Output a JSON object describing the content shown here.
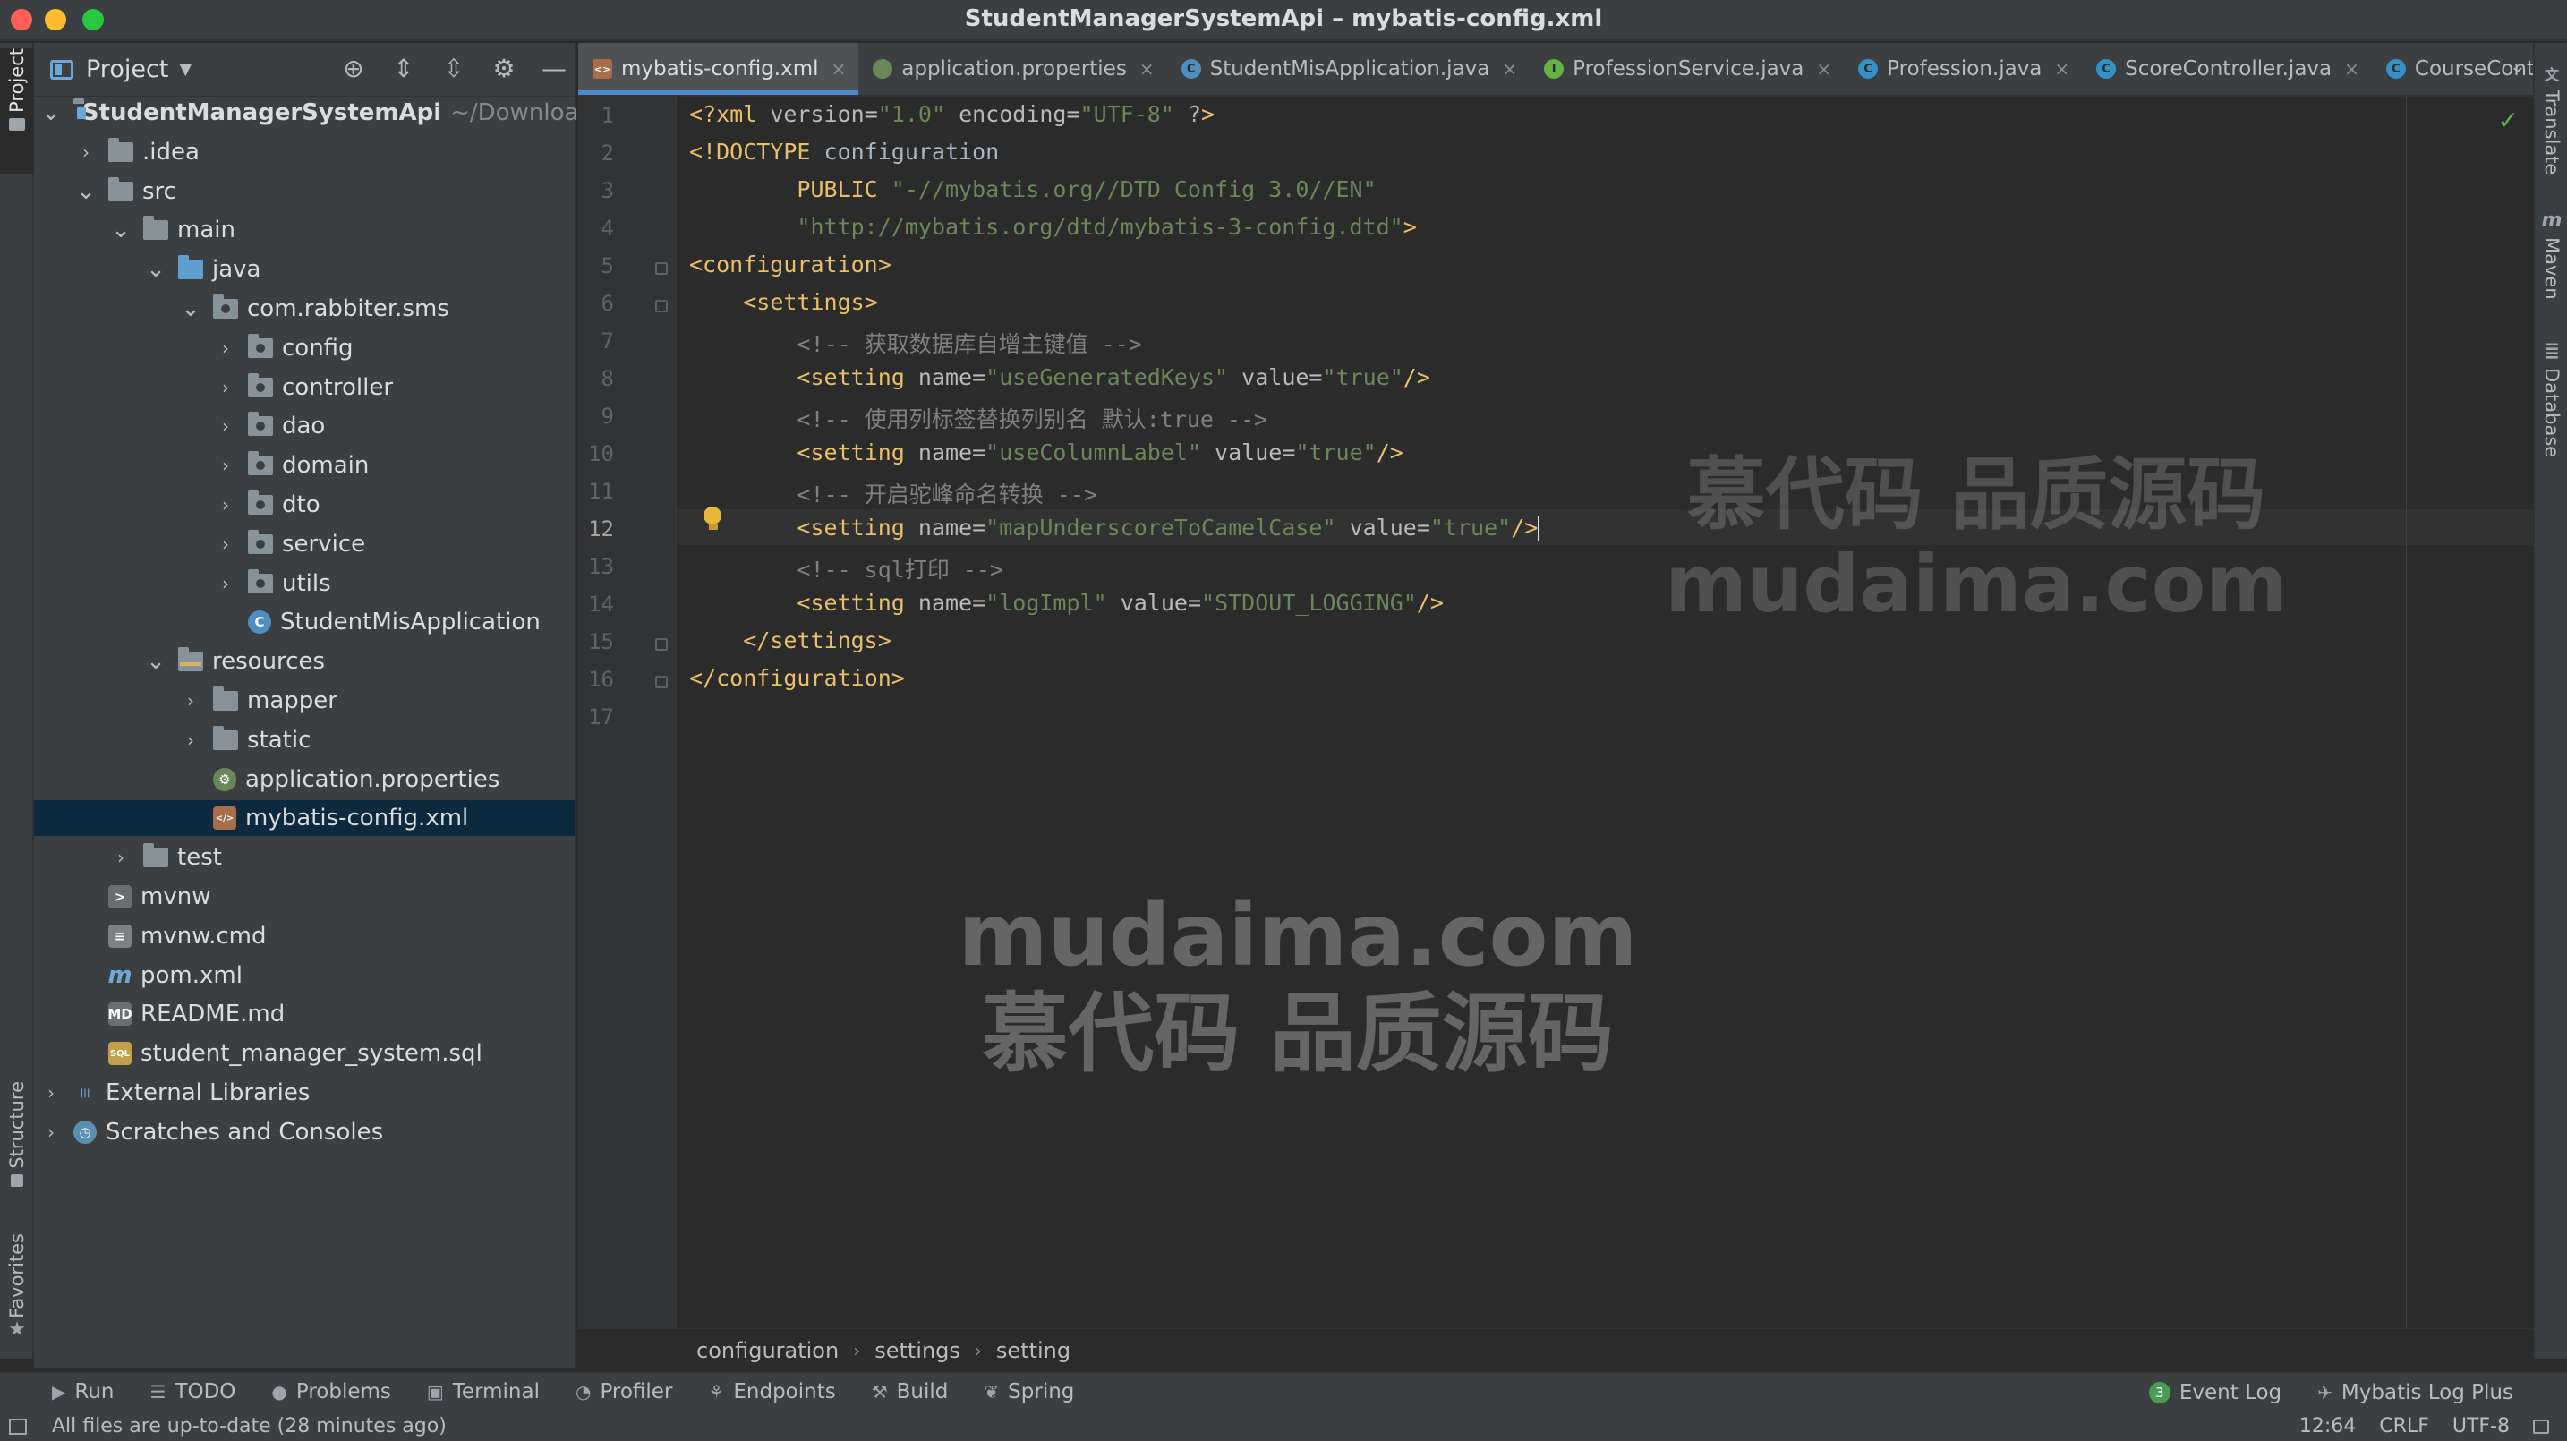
{
  "window": {
    "title": "StudentManagerSystemApi – mybatis-config.xml"
  },
  "left_strip": {
    "project": "Project",
    "structure": "Structure",
    "favorites": "Favorites"
  },
  "right_strip": {
    "translate": "Translate",
    "maven": "Maven",
    "database": "Database"
  },
  "project_panel": {
    "title": "Project",
    "tree": [
      {
        "label": "StudentManagerSystemApi",
        "sub": "~/Downloads",
        "icon": "project-folder-icon",
        "depth": 0,
        "expanded": true,
        "bold": true
      },
      {
        "label": ".idea",
        "icon": "folder-icon",
        "depth": 1,
        "expanded": false
      },
      {
        "label": "src",
        "icon": "folder-icon",
        "depth": 1,
        "expanded": true
      },
      {
        "label": "main",
        "icon": "folder-icon",
        "depth": 2,
        "expanded": true
      },
      {
        "label": "java",
        "icon": "source-folder-icon",
        "depth": 3,
        "expanded": true
      },
      {
        "label": "com.rabbiter.sms",
        "icon": "package-icon",
        "depth": 4,
        "expanded": true
      },
      {
        "label": "config",
        "icon": "package-icon",
        "depth": 5,
        "expanded": false
      },
      {
        "label": "controller",
        "icon": "package-icon",
        "depth": 5,
        "expanded": false
      },
      {
        "label": "dao",
        "icon": "package-icon",
        "depth": 5,
        "expanded": false
      },
      {
        "label": "domain",
        "icon": "package-icon",
        "depth": 5,
        "expanded": false
      },
      {
        "label": "dto",
        "icon": "package-icon",
        "depth": 5,
        "expanded": false
      },
      {
        "label": "service",
        "icon": "package-icon",
        "depth": 5,
        "expanded": false
      },
      {
        "label": "utils",
        "icon": "package-icon",
        "depth": 5,
        "expanded": false
      },
      {
        "label": "StudentMisApplication",
        "icon": "spring-boot-class-icon",
        "depth": 5,
        "leaf": true
      },
      {
        "label": "resources",
        "icon": "resources-folder-icon",
        "depth": 3,
        "expanded": true
      },
      {
        "label": "mapper",
        "icon": "folder-icon",
        "depth": 4,
        "expanded": false
      },
      {
        "label": "static",
        "icon": "folder-icon",
        "depth": 4,
        "expanded": false
      },
      {
        "label": "application.properties",
        "icon": "properties-file-icon",
        "depth": 4,
        "leaf": true
      },
      {
        "label": "mybatis-config.xml",
        "icon": "xml-file-icon",
        "depth": 4,
        "leaf": true,
        "selected": true
      },
      {
        "label": "test",
        "icon": "folder-icon",
        "depth": 2,
        "expanded": false
      },
      {
        "label": "mvnw",
        "icon": "shell-script-icon",
        "depth": 1,
        "leaf": true
      },
      {
        "label": "mvnw.cmd",
        "icon": "text-file-icon",
        "depth": 1,
        "leaf": true
      },
      {
        "label": "pom.xml",
        "icon": "maven-icon",
        "depth": 1,
        "leaf": true
      },
      {
        "label": "README.md",
        "icon": "markdown-file-icon",
        "depth": 1,
        "leaf": true
      },
      {
        "label": "student_manager_system.sql",
        "icon": "sql-file-icon",
        "depth": 1,
        "leaf": true
      },
      {
        "label": "External Libraries",
        "icon": "libraries-icon",
        "depth": 0,
        "expanded": false
      },
      {
        "label": "Scratches and Consoles",
        "icon": "scratches-icon",
        "depth": 0,
        "expanded": false
      }
    ]
  },
  "tabs": [
    {
      "label": "mybatis-config.xml",
      "icon": "xml-file-icon",
      "active": true
    },
    {
      "label": "application.properties",
      "icon": "properties-file-icon"
    },
    {
      "label": "StudentMisApplication.java",
      "icon": "spring-boot-class-icon"
    },
    {
      "label": "ProfessionService.java",
      "icon": "interface-icon"
    },
    {
      "label": "Profession.java",
      "icon": "class-icon"
    },
    {
      "label": "ScoreController.java",
      "icon": "class-icon"
    },
    {
      "label": "CourseController.ja",
      "icon": "class-icon",
      "no_close": true
    }
  ],
  "editor": {
    "current_line": 12,
    "lines": [
      "<?xml version=\"1.0\" encoding=\"UTF-8\" ?>",
      "<!DOCTYPE configuration",
      "        PUBLIC \"-//mybatis.org//DTD Config 3.0//EN\"",
      "        \"http://mybatis.org/dtd/mybatis-3-config.dtd\">",
      "<configuration>",
      "    <settings>",
      "        <!-- 获取数据库自增主键值 -->",
      "        <setting name=\"useGeneratedKeys\" value=\"true\"/>",
      "        <!-- 使用列标签替换列别名 默认:true -->",
      "        <setting name=\"useColumnLabel\" value=\"true\"/>",
      "        <!-- 开启驼峰命名转换 -->",
      "        <setting name=\"mapUnderscoreToCamelCase\" value=\"true\"/>",
      "        <!-- sql打印 -->",
      "        <setting name=\"logImpl\" value=\"STDOUT_LOGGING\"/>",
      "    </settings>",
      "</configuration>",
      ""
    ]
  },
  "watermark": {
    "line1": "mudaima.com",
    "line2": "慕代码 品质源码"
  },
  "breadcrumb": [
    "configuration",
    "settings",
    "setting"
  ],
  "toolwindows": {
    "left": [
      "Run",
      "TODO",
      "Problems",
      "Terminal",
      "Profiler",
      "Endpoints",
      "Build",
      "Spring"
    ],
    "event_log_count": "3",
    "event_log": "Event Log",
    "mybatis_log": "Mybatis Log Plus"
  },
  "status": {
    "message": "All files are up-to-date (28 minutes ago)",
    "position": "12:64",
    "line_ending": "CRLF",
    "encoding": "UTF-8"
  }
}
